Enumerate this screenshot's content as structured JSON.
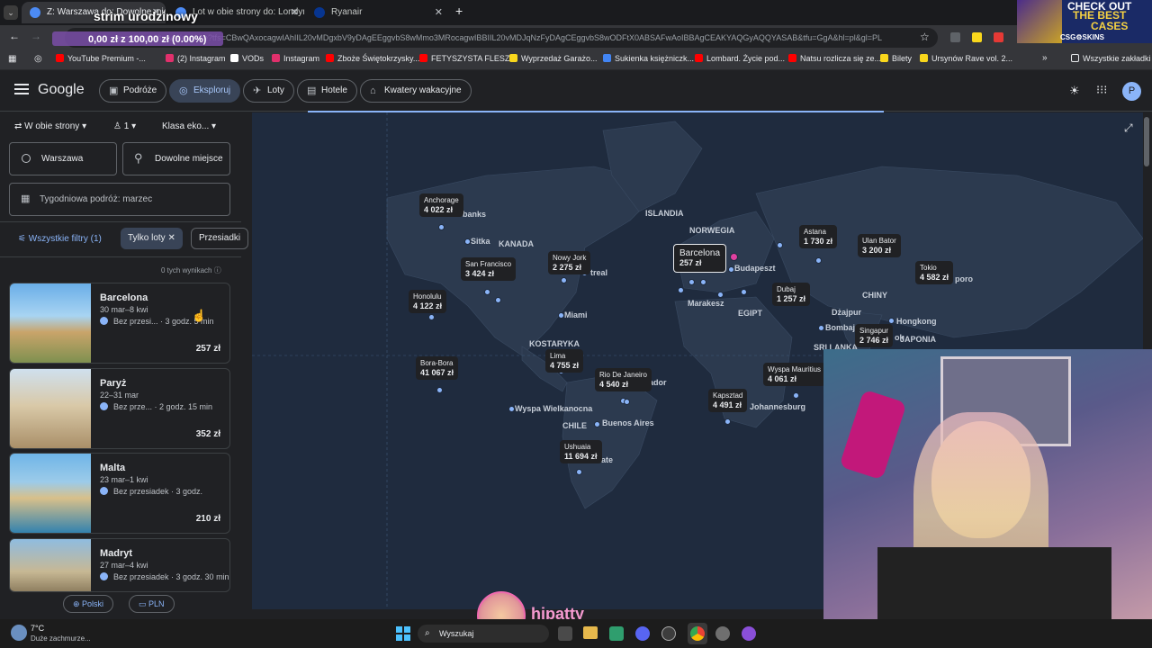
{
  "browser": {
    "tabs": [
      {
        "label": "Z: Warszawa do: Dowolne miejsc"
      },
      {
        "label": "Lot w obie strony do: Londyn |"
      },
      {
        "label": "Ryanair"
      }
    ],
    "stream_title": "strim urodzinowy",
    "address": "google.com/travel/explore?tfs=CBwQAxocagwIAhIIL20vMDgxbV9yDAgEEggvbS8wMmo3MRocagwIBBIIL20vMDJqNzFyDAgCEggvbS8wODFtX0ABSAFwAoIBBAgCEAKYAQGyAQQYASAB&tfu=GgA&hl=pl&gl=PL",
    "donation_text": "0,00 zł z 100,00 zł (0.00%)",
    "bookmarks": [
      {
        "label": "YouTube Premium -...",
        "color": "#ff0000"
      },
      {
        "label": "(2) Instagram",
        "color": "#e1306c"
      },
      {
        "label": "VODs",
        "color": "#ffffff"
      },
      {
        "label": "Instagram",
        "color": "#e1306c"
      },
      {
        "label": "Zboże Świętokrzysky...",
        "color": "#ff0000"
      },
      {
        "label": "FETYSZYSTA FLESZ...",
        "color": "#ff0000"
      },
      {
        "label": "Wyprzedaż Garażo...",
        "color": "#f9d71c"
      },
      {
        "label": "Sukienka księżniczk...",
        "color": "#4285f4"
      },
      {
        "label": "Lombard. Życie pod...",
        "color": "#ff0000"
      },
      {
        "label": "Natsu rozlicza się ze...",
        "color": "#ff0000"
      },
      {
        "label": "Bilety",
        "color": "#f9d71c"
      },
      {
        "label": "Ursynów Rave vol. 2...",
        "color": "#f9d71c"
      }
    ],
    "all_bookmarks_label": "Wszystkie zakładki",
    "ad": {
      "line1": "CHECK OUT",
      "line2": "THE BEST",
      "line3": "CASES",
      "brand": "CSG⚙SKINS"
    }
  },
  "google": {
    "logo": "Google",
    "nav": [
      {
        "label": "Podróże",
        "icon": "suitcase-icon"
      },
      {
        "label": "Eksploruj",
        "icon": "explore-icon"
      },
      {
        "label": "Loty",
        "icon": "plane-icon"
      },
      {
        "label": "Hotele",
        "icon": "bed-icon"
      },
      {
        "label": "Kwatery wakacyjne",
        "icon": "house-icon"
      }
    ],
    "avatar_letter": "P"
  },
  "search": {
    "trip_type": "W obie strony",
    "passengers": "1",
    "class": "Klasa eko...",
    "origin": "Warszawa",
    "destination": "Dowolne miejsce",
    "dates": "Tygodniowa podróż: marzec",
    "filters": {
      "all": "Wszystkie filtry (1)",
      "active": "Tylko loty",
      "next": "Przesiadki"
    },
    "results_info": "0 tych wynikach"
  },
  "results": [
    {
      "city": "Barcelona",
      "dates": "30 mar–8 kwi",
      "info": "Bez przesi...  · 3 godz. 5 min",
      "price": "257 zł"
    },
    {
      "city": "Paryż",
      "dates": "22–31 mar",
      "info": "Bez prze...  · 2 godz. 15 min",
      "price": "352 zł"
    },
    {
      "city": "Malta",
      "dates": "23 mar–1 kwi",
      "info": "Bez przesiadek · 3 godz.",
      "price": "210 zł"
    },
    {
      "city": "Madryt",
      "dates": "27 mar–4 kwi",
      "info": "Bez przesiadek · 3 godz. 30 min",
      "price": ""
    }
  ],
  "footer": {
    "language": "Polski",
    "currency": "PLN"
  },
  "map": {
    "region_labels": [
      "ISLANDIA",
      "NORWEGIA",
      "KANADA",
      "CHINY",
      "EGIPT",
      "KOSTARYKA",
      "CHILE",
      "SRI LANKA",
      "JAPONIA"
    ],
    "city_labels": [
      "Sitka",
      "Miami",
      "Marakesz",
      "Budapeszt",
      "Dżajpur",
      "Bombaj",
      "Hongkong",
      "Buenos Aires",
      "Johannesburg",
      "Wyspa Wielkanocna",
      "banks",
      "treal",
      "ador",
      "ok",
      "poro",
      "ate"
    ],
    "prices": [
      {
        "city": "Anchorage",
        "price": "4 022 zł"
      },
      {
        "city": "San Francisco",
        "price": "3 424 zł"
      },
      {
        "city": "Nowy Jork",
        "price": "2 275 zł"
      },
      {
        "city": "Honolulu",
        "price": "4 122 zł"
      },
      {
        "city": "Bora-Bora",
        "price": "41 067 zł"
      },
      {
        "city": "Lima",
        "price": "4 755 zł"
      },
      {
        "city": "Rio De Janeiro",
        "price": "4 540 zł"
      },
      {
        "city": "Ushuaia",
        "price": "11 694 zł"
      },
      {
        "city": "Barcelona",
        "price": "257 zł"
      },
      {
        "city": "Astana",
        "price": "1 730 zł"
      },
      {
        "city": "Ulan Bator",
        "price": "3 200 zł"
      },
      {
        "city": "Tokio",
        "price": "4 582 zł"
      },
      {
        "city": "Dubaj",
        "price": "1 257 zł"
      },
      {
        "city": "Singapur",
        "price": "2 746 zł"
      },
      {
        "city": "Wyspa Mauritius",
        "price": "4 061 zł"
      },
      {
        "city": "Kapsztad",
        "price": "4 491 zł"
      }
    ]
  },
  "stream": {
    "streamer": "hipatty"
  },
  "taskbar": {
    "temperature": "7°C",
    "weather": "Duże zachmurze...",
    "search": "Wyszukaj"
  },
  "colors": {
    "accent": "#8ab4f8",
    "map_water": "#1f2b3e",
    "map_land": "#2c3a4f",
    "selected_chip": "#394457",
    "pink_pin": "#e040a0"
  }
}
